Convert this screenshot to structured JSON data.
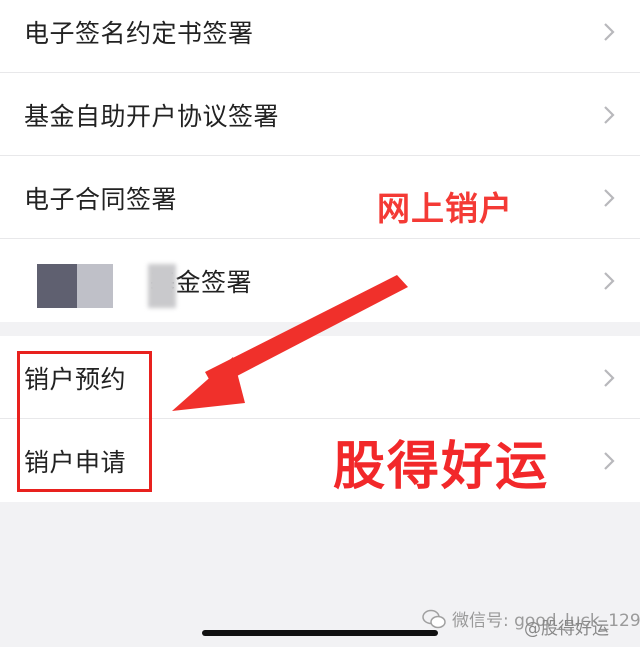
{
  "list_group_1": [
    {
      "label": "电子签名约定书签署"
    },
    {
      "label": "基金自助开户协议签署"
    },
    {
      "label": "电子合同签署"
    },
    {
      "label": "基金签署"
    }
  ],
  "list_group_2": [
    {
      "label": "销户预约"
    },
    {
      "label": "销户申请"
    }
  ],
  "annotations": {
    "online_close": "网上销户",
    "slogan": "股得好运"
  },
  "watermark": {
    "wechat": "微信号: good_luck_129",
    "handle": "@股得好运"
  },
  "colors": {
    "accent_red": "#e8211e",
    "background": "#f2f2f4"
  }
}
